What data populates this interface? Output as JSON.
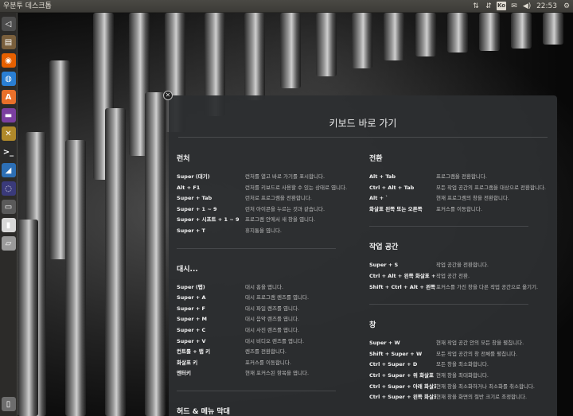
{
  "panel": {
    "title": "우분투 데스크톱",
    "keyboard_indicator": "Ko",
    "clock": "22:53",
    "icons": [
      "sort-icon",
      "network-icon",
      "keyboard-layout-icon",
      "mail-icon",
      "volume-icon",
      "clock",
      "settings-gear-icon"
    ]
  },
  "launcher": {
    "items": [
      {
        "name": "dash-back-icon",
        "color": "#4c4c4c"
      },
      {
        "name": "files-icon",
        "color": "#7a5f3c"
      },
      {
        "name": "firefox-icon",
        "color": "#e66000"
      },
      {
        "name": "browser-icon",
        "color": "#2a7fd4"
      },
      {
        "name": "software-center-icon",
        "color": "#e9702a"
      },
      {
        "name": "office-icon",
        "color": "#7b3fa0"
      },
      {
        "name": "tools-icon",
        "color": "#b0892a"
      },
      {
        "name": "terminal-icon",
        "color": "#2b2b2b"
      },
      {
        "name": "wing-app-icon",
        "color": "#2d6fb5"
      },
      {
        "name": "workspace-switcher-icon",
        "color": "#3a3a7a"
      },
      {
        "name": "drive-icon",
        "color": "#5a5a5a"
      },
      {
        "name": "usb-drive-icon",
        "color": "#d8d8d8"
      },
      {
        "name": "removable-disk-icon",
        "color": "#9a9a9a"
      },
      {
        "name": "trash-icon",
        "color": "#6d6d6d"
      }
    ]
  },
  "overlay": {
    "title": "키보드 바로 가기",
    "left_sections": [
      {
        "heading": "런처",
        "rows": [
          {
            "key": "Super (대기)",
            "desc": "런처를 열고 바로 가기를 표시합니다."
          },
          {
            "key": "Alt + F1",
            "desc": "런처를 키보드로 사용할 수 있는 상태로 엽니다."
          },
          {
            "key": "Super + Tab",
            "desc": "런처로 프로그램을 전환합니다."
          },
          {
            "key": "Super + 1 ~ 9",
            "desc": "런처 아이콘을 누르는 것과 같습니다."
          },
          {
            "key": "Super + 시프트 + 1 ~ 9",
            "desc": "프로그램 안에서 새 창을 엽니다."
          },
          {
            "key": "Super + T",
            "desc": "휴지통을 엽니다."
          }
        ]
      },
      {
        "heading": "대시...",
        "rows": [
          {
            "key": "Super (탭)",
            "desc": "대시 홈을 엽니다."
          },
          {
            "key": "Super + A",
            "desc": "대시 프로그램 렌즈를 엽니다."
          },
          {
            "key": "Super + F",
            "desc": "대시 파일 렌즈를 엽니다."
          },
          {
            "key": "Super + M",
            "desc": "대시 음악 렌즈를 엽니다."
          },
          {
            "key": "Super + C",
            "desc": "대시 사진 렌즈를 엽니다."
          },
          {
            "key": "Super + V",
            "desc": "대시 비디오 렌즈를 엽니다."
          },
          {
            "key": "컨트롤 + 탭 키",
            "desc": "렌즈를 전환합니다."
          },
          {
            "key": "화살표 키",
            "desc": "포커스를 이동합니다."
          },
          {
            "key": "엔터키",
            "desc": "현재 포커스된 항목을 엽니다."
          }
        ]
      },
      {
        "heading": "허드 & 메뉴 막대",
        "rows": []
      }
    ],
    "right_sections": [
      {
        "heading": "전환",
        "rows": [
          {
            "key": "Alt + Tab",
            "desc": "프로그램을 전환합니다."
          },
          {
            "key": "Ctrl + Alt + Tab",
            "desc": "모든 작업 공간의 프로그램을 대상으로 전환합니다."
          },
          {
            "key": "Alt + `",
            "desc": "현재 프로그램의 창을 전환합니다."
          },
          {
            "key": "화살표 왼쪽 또는 오른쪽",
            "desc": "포커스를 이동합니다."
          }
        ]
      },
      {
        "heading": "작업 공간",
        "rows": [
          {
            "key": "Super + S",
            "desc": "작업 공간을 전환합니다."
          },
          {
            "key": "Ctrl + Alt + 왼쪽 화살표 + ...",
            "desc": "작업 공간 전환."
          },
          {
            "key": "Shift + Ctrl + Alt + 왼쪽 ...",
            "desc": "포커스를 가진 창을 다른 작업 공간으로 옮기기."
          }
        ]
      },
      {
        "heading": "창",
        "rows": [
          {
            "key": "Super + W",
            "desc": "현재 작업 공간 안의 모든 창을 펼칩니다."
          },
          {
            "key": "Shift + Super + W",
            "desc": "모든 작업 공간의 창 전체를 펼칩니다."
          },
          {
            "key": "Ctrl + Super + D",
            "desc": "모든 창을 최소화합니다."
          },
          {
            "key": "Ctrl + Super + 위 화살표",
            "desc": "현재 창을 최대화합니다."
          },
          {
            "key": "Ctrl + Super + 아래 화살표",
            "desc": "현재 창을 최소화하거나 최소화를 취소합니다."
          },
          {
            "key": "Ctrl + Super + 왼쪽 화살표",
            "desc": "현재 창을 화면의 절반 크기로 조정합니다."
          }
        ]
      }
    ]
  }
}
